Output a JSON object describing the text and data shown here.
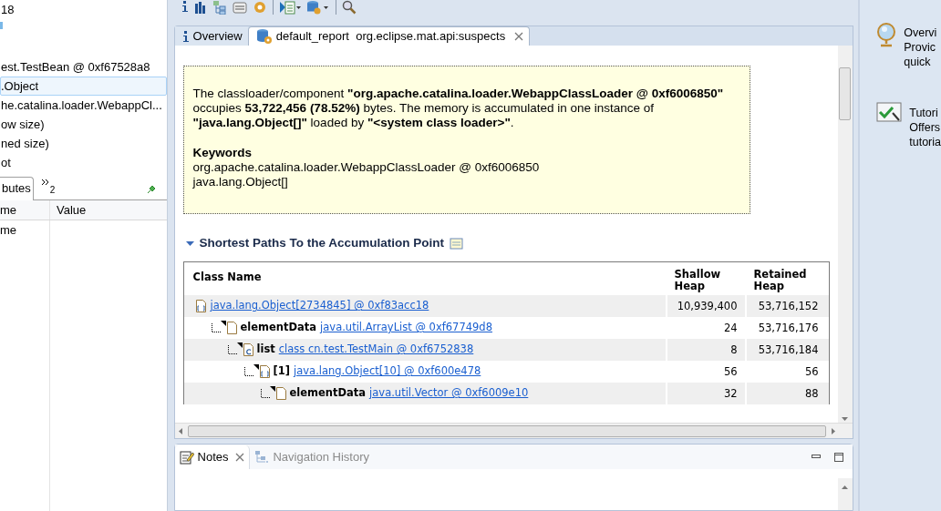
{
  "left_panel": {
    "tree_items": [
      {
        "label": "18",
        "selected": false
      },
      {
        "label": "est.TestBean @ 0xf67528a8",
        "selected": false
      },
      {
        "label": ".Object",
        "selected": true
      },
      {
        "label": "he.catalina.loader.WebappCl...",
        "selected": false
      },
      {
        "label": "ow size)",
        "selected": false
      },
      {
        "label": "ned size)",
        "selected": false
      },
      {
        "label": "ot",
        "selected": false
      }
    ],
    "tabs": [
      {
        "label": "butes",
        "selected": true
      }
    ],
    "overflow_count": "2",
    "columns": [
      "me",
      "Value"
    ],
    "rows": [
      {
        "name": "me"
      }
    ]
  },
  "editor_tabs": [
    {
      "kind": "info",
      "label": "Overview",
      "selected": false,
      "closable": false
    },
    {
      "kind": "report",
      "label": "default_report  org.eclipse.mat.api:suspects",
      "selected": true,
      "closable": true
    }
  ],
  "description": {
    "paragraph": "The classloader/component **\"org.apache.catalina.loader.WebappClassLoader @ 0xf6006850\"** occupies **53,722,456 (78.52%)** bytes. The memory is accumulated in one instance of **\"java.lang.Object[]\"** loaded by **\"<system class loader>\"**.",
    "keywords_title": "Keywords",
    "keywords": [
      "org.apache.catalina.loader.WebappClassLoader @ 0xf6006850",
      "java.lang.Object[]"
    ]
  },
  "section": {
    "title": "Shortest Paths To the Accumulation Point",
    "expanded": true
  },
  "table": {
    "columns": [
      "Class Name",
      "Shallow Heap",
      "Retained Heap"
    ],
    "rows": [
      {
        "kind": "array",
        "link": "java.lang.Object[2734845] @ 0xf83acc18",
        "shallow": "10,939,400",
        "retained": "53,716,152",
        "children": [
          {
            "kind": "object",
            "field": "elementData",
            "link": "java.util.ArrayList @ 0xf67749d8",
            "shallow": "24",
            "retained": "53,716,176",
            "children": [
              {
                "kind": "class",
                "field": "list",
                "link": "class cn.test.TestMain @ 0xf6752838",
                "shallow": "8",
                "retained": "53,716,184",
                "children": [
                  {
                    "kind": "array",
                    "field": "[1]",
                    "link": "java.lang.Object[10] @ 0xf600e478",
                    "shallow": "56",
                    "retained": "56",
                    "children": [
                      {
                        "kind": "object",
                        "field": "elementData",
                        "link": "java.util.Vector @ 0xf6009e10",
                        "shallow": "32",
                        "retained": "88"
                      }
                    ]
                  }
                ]
              }
            ]
          }
        ]
      }
    ]
  },
  "bottom_tabs": [
    {
      "kind": "notes",
      "label": "Notes",
      "selected": true,
      "closable": true
    },
    {
      "kind": "history",
      "label": "Navigation History",
      "selected": false,
      "closable": false
    }
  ],
  "right_panel": {
    "items": [
      {
        "kind": "globe",
        "lines": [
          "Overvi",
          "Provic",
          "quick"
        ]
      },
      {
        "kind": "tutorial",
        "lines": [
          "Tutori",
          "Offers",
          "tutoria"
        ]
      }
    ]
  }
}
